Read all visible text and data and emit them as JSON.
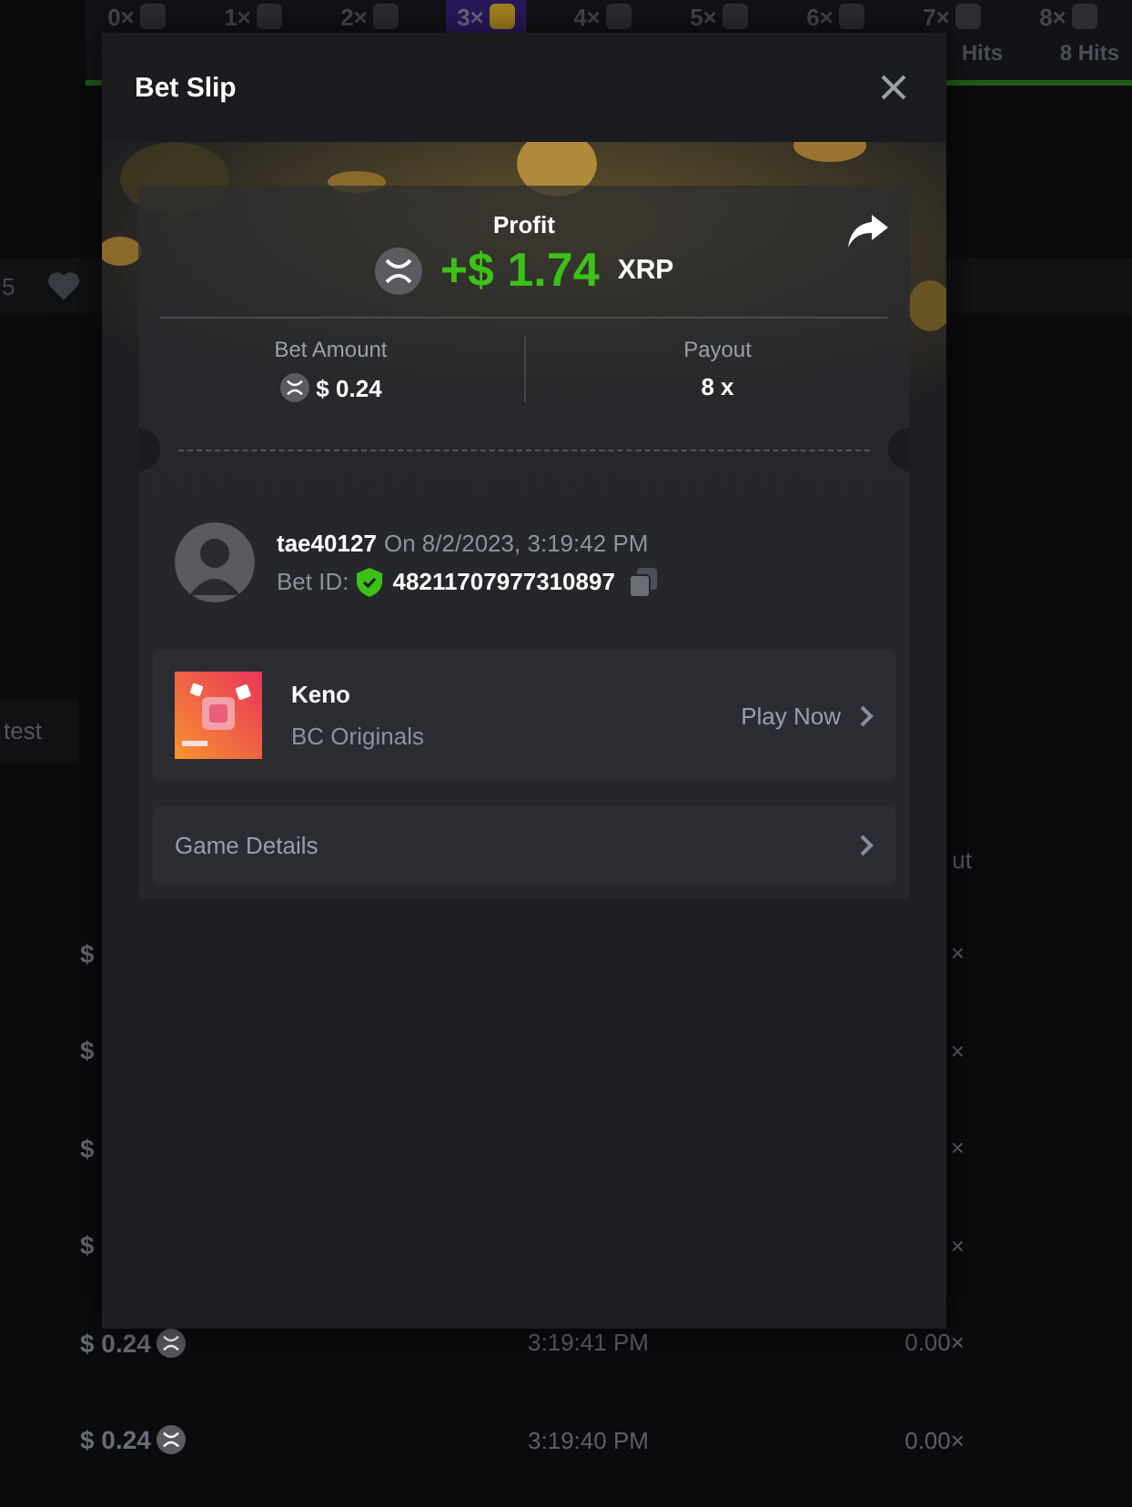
{
  "multipliers": [
    {
      "label": "0×",
      "selected": false
    },
    {
      "label": "1×",
      "selected": false
    },
    {
      "label": "2×",
      "selected": false
    },
    {
      "label": "3×",
      "selected": true
    },
    {
      "label": "4×",
      "selected": false
    },
    {
      "label": "5×",
      "selected": false
    },
    {
      "label": "6×",
      "selected": false
    },
    {
      "label": "7×",
      "selected": false,
      "hits": "Hits"
    },
    {
      "label": "8×",
      "selected": false,
      "hits": "8 Hits"
    }
  ],
  "stats": {
    "count": "5"
  },
  "tab": "test",
  "table": {
    "column": "ut",
    "rows": [
      {
        "amount": "$",
        "coin": false,
        "payout": "×"
      },
      {
        "amount": "$",
        "coin": false,
        "payout": "×"
      },
      {
        "amount": "$",
        "coin": false,
        "payout": "×"
      },
      {
        "amount": "$",
        "coin": false,
        "payout": "×"
      },
      {
        "amount": "$ 0.24",
        "coin": true,
        "time": "3:19:41 PM",
        "payout": "0.00×"
      },
      {
        "amount": "$ 0.24",
        "coin": true,
        "time": "3:19:40 PM",
        "payout": "0.00×"
      }
    ]
  },
  "modal": {
    "title": "Bet Slip",
    "profit_label": "Profit",
    "profit": "+$ 1.74",
    "currency": "XRP",
    "bet_amount_label": "Bet Amount",
    "bet_amount": "$ 0.24",
    "payout_label": "Payout",
    "payout": "8 x",
    "user": "tae40127",
    "date": "On 8/2/2023, 3:19:42 PM",
    "bet_id_label": "Bet ID:",
    "bet_id": "48211707977310897",
    "game": {
      "name": "Keno",
      "provider": "BC Originals",
      "action": "Play Now"
    },
    "details": "Game Details"
  }
}
